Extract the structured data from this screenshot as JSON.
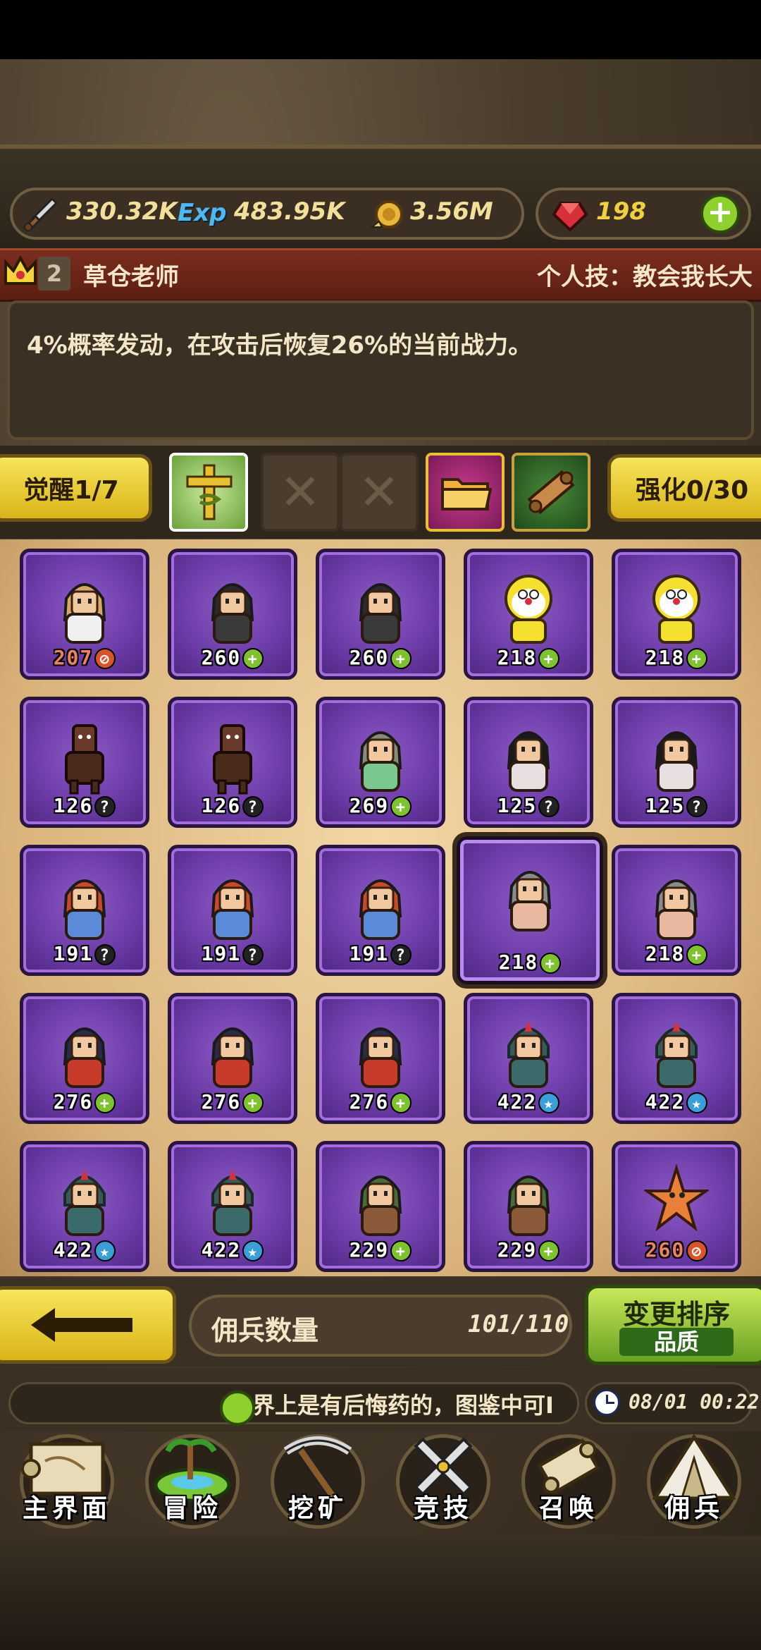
{
  "resources": {
    "attack": "330.32K",
    "exp_label": "Exp",
    "exp": "483.95K",
    "gold": "3.56M",
    "gems": "198"
  },
  "hero": {
    "rank": "2",
    "name": "草仓老师",
    "skill_label": "个人技：教会我长大",
    "skill_desc": "4%概率发动，在攻击后恢复26%的当前战力。"
  },
  "awaken_label": "觉醒1/7",
  "enhance_label": "强化0/30",
  "mercenaries": [
    {
      "level": "207",
      "badge": "rank",
      "type": "girl-blonde"
    },
    {
      "level": "260",
      "badge": "plus",
      "type": "suit-man"
    },
    {
      "level": "260",
      "badge": "plus",
      "type": "suit-man"
    },
    {
      "level": "218",
      "badge": "plus",
      "type": "doraemon-yellow"
    },
    {
      "level": "218",
      "badge": "plus",
      "type": "doraemon-yellow"
    },
    {
      "level": "126",
      "badge": "question",
      "type": "horse"
    },
    {
      "level": "126",
      "badge": "question",
      "type": "horse"
    },
    {
      "level": "269",
      "badge": "plus",
      "type": "old-sage"
    },
    {
      "level": "125",
      "badge": "question",
      "type": "girl-pigtails"
    },
    {
      "level": "125",
      "badge": "question",
      "type": "girl-pigtails"
    },
    {
      "level": "191",
      "badge": "question",
      "type": "redhead-boy"
    },
    {
      "level": "191",
      "badge": "question",
      "type": "redhead-boy"
    },
    {
      "level": "191",
      "badge": "question",
      "type": "redhead-boy"
    },
    {
      "level": "218",
      "badge": "plus",
      "type": "grey-hair-girl",
      "selected": true
    },
    {
      "level": "218",
      "badge": "plus",
      "type": "grey-hair-girl"
    },
    {
      "level": "276",
      "badge": "plus",
      "type": "dark-hair-woman"
    },
    {
      "level": "276",
      "badge": "plus",
      "type": "dark-hair-woman"
    },
    {
      "level": "276",
      "badge": "plus",
      "type": "dark-hair-woman"
    },
    {
      "level": "422",
      "badge": "star",
      "type": "hooded-mage"
    },
    {
      "level": "422",
      "badge": "star",
      "type": "hooded-mage"
    },
    {
      "level": "422",
      "badge": "star",
      "type": "hooded-mage"
    },
    {
      "level": "422",
      "badge": "star",
      "type": "hooded-mage"
    },
    {
      "level": "229",
      "badge": "plus",
      "type": "soldier"
    },
    {
      "level": "229",
      "badge": "plus",
      "type": "soldier"
    },
    {
      "level": "260",
      "badge": "rank",
      "type": "starfish"
    }
  ],
  "footer": {
    "count_label": "佣兵数量",
    "count_value": "101/110",
    "sort_title": "变更排序",
    "sort_mode": "品质"
  },
  "ticker_text": "世界上是有后悔药的，图鉴中可I",
  "clock_text": "08/01 00:22",
  "nav": [
    {
      "label": "主界面",
      "icon": "scroll-map-icon"
    },
    {
      "label": "冒险",
      "icon": "island-icon"
    },
    {
      "label": "挖矿",
      "icon": "pickaxe-icon"
    },
    {
      "label": "竞技",
      "icon": "crossed-swords-icon"
    },
    {
      "label": "召唤",
      "icon": "summon-scroll-icon"
    },
    {
      "label": "佣兵",
      "icon": "tent-icon"
    }
  ],
  "colors": {
    "accent_yellow": "#e8cf33",
    "card_purple": "#6a3aa5",
    "badge_plus": "#7ec32f",
    "badge_question": "#222222",
    "badge_star": "#3a9ed8",
    "badge_rank": "#d8552b"
  }
}
